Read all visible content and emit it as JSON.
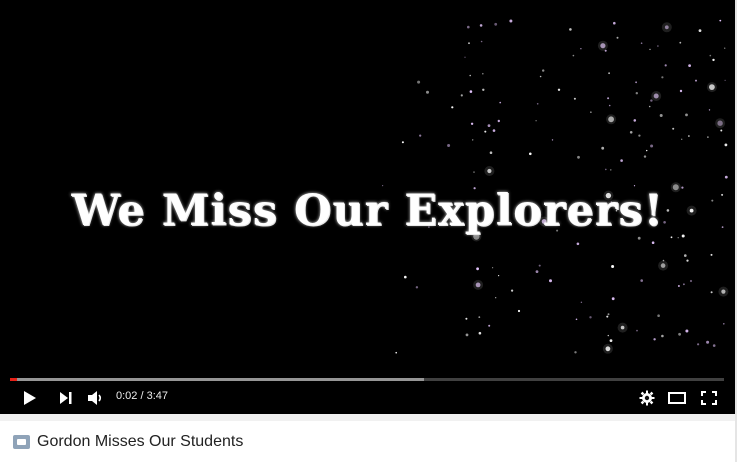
{
  "video": {
    "headline": "We Miss Our Explorers!",
    "progress_played": 0.01,
    "progress_loaded": 0.58
  },
  "controls": {
    "time": "0:02 / 3:47",
    "icons": [
      "play-icon",
      "next-icon",
      "volume-icon",
      "gear-icon",
      "theater-icon",
      "fullscreen-icon"
    ]
  },
  "title_bar": {
    "title": "Gordon Misses Our Students"
  },
  "colors": {
    "progress_played": "#e62117",
    "player_bg": "#000000"
  }
}
